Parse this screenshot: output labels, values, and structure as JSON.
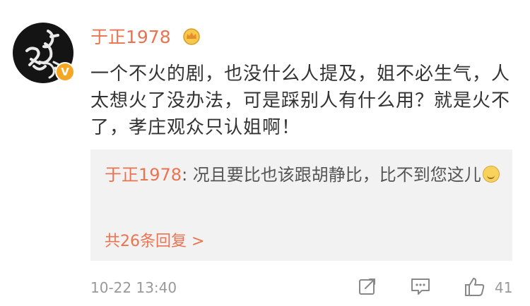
{
  "comment": {
    "username": "于正1978",
    "content": "一个不火的剧，也没什么人提及，姐不必生气，人太想火了没办法，可是踩别人有什么用？就是火不了，孝庄观众只认姐啊！",
    "verified_badge": "V",
    "timestamp": "10-22 13:40",
    "like_count": "41"
  },
  "reply": {
    "username": "于正1978",
    "separator": ": ",
    "text": "况且要比也该跟胡静比，比不到您这儿",
    "count_label": "共26条回复 >"
  },
  "icons": {
    "avatar": "avatar-calligraphy",
    "crown": "crown-icon",
    "share": "share-icon",
    "comment": "comment-icon",
    "like": "thumbs-up-icon"
  },
  "colors": {
    "username": "#eb7350",
    "text": "#333333",
    "meta": "#999999",
    "reply_bg": "#f2f2f2"
  }
}
